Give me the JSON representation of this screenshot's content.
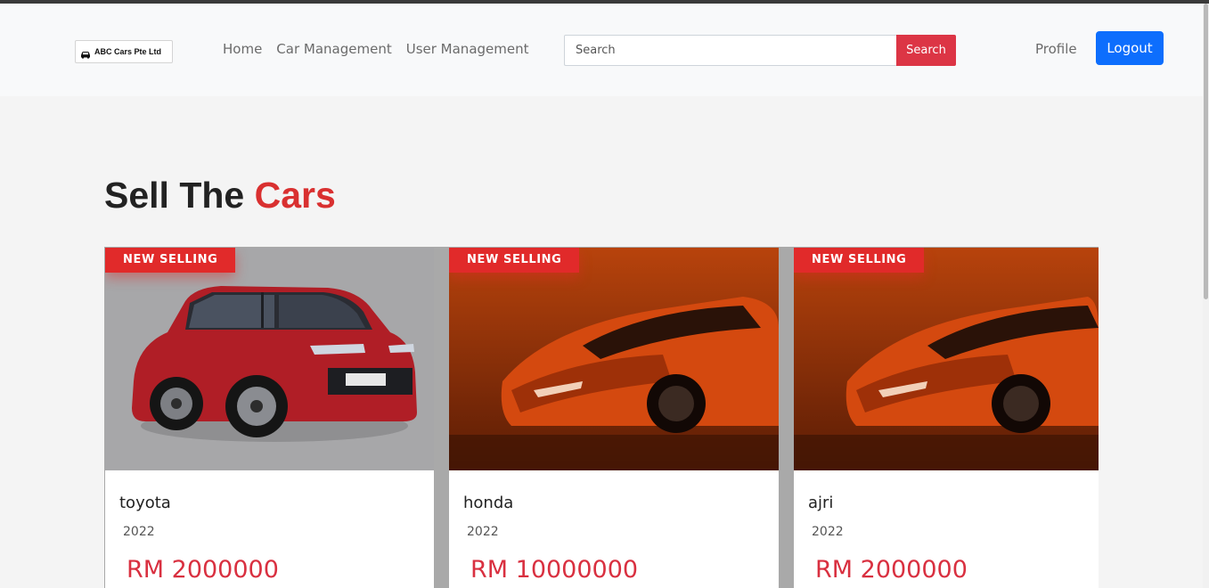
{
  "app": {
    "logo_text": "ABC Cars Pte Ltd",
    "logo_icon": "car-icon"
  },
  "nav": {
    "items": [
      {
        "label": "Home"
      },
      {
        "label": "Car Management"
      },
      {
        "label": "User Management"
      }
    ]
  },
  "search": {
    "placeholder": "Search",
    "value": "",
    "button_label": "Search"
  },
  "header_right": {
    "profile_label": "Profile",
    "logout_label": "Logout"
  },
  "section": {
    "title_main": "Sell The",
    "title_accent": "Cars"
  },
  "cards": [
    {
      "badge": "NEW SELLING",
      "name": "toyota",
      "year": "2022",
      "price": "RM 2000000",
      "image": "red-hatchback-photo"
    },
    {
      "badge": "NEW SELLING",
      "name": "honda",
      "year": "2022",
      "price": "RM 10000000",
      "image": "orange-sports-car-photo"
    },
    {
      "badge": "NEW SELLING",
      "name": "ajri",
      "year": "2022",
      "price": "RM 2000000",
      "image": "orange-sports-car-photo"
    }
  ],
  "colors": {
    "accent_red": "#dc3545",
    "primary_blue": "#0d6efd",
    "badge_red": "#e12a2a",
    "price_red": "#d93040"
  }
}
